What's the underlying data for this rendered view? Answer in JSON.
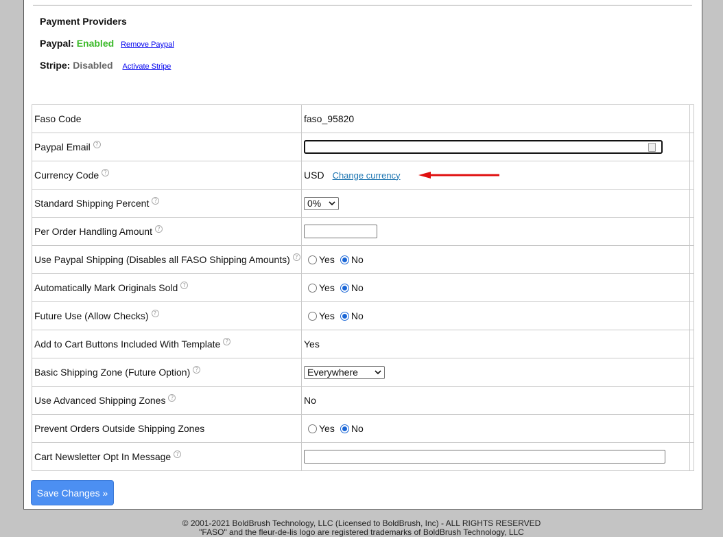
{
  "payment": {
    "title": "Payment Providers",
    "paypal": {
      "label": "Paypal:",
      "status": "Enabled",
      "action": "Remove Paypal"
    },
    "stripe": {
      "label": "Stripe:",
      "status": "Disabled",
      "action": "Activate Stripe"
    }
  },
  "rows": [
    {
      "label": "Faso Code",
      "value": "faso_95820"
    },
    {
      "label": "Paypal Email",
      "value": ""
    },
    {
      "label": "Currency Code",
      "value": "USD",
      "link": "Change currency"
    },
    {
      "label": "Standard Shipping Percent",
      "value": "0%"
    },
    {
      "label": "Per Order Handling Amount",
      "value": ""
    },
    {
      "label": "Use Paypal Shipping (Disables all FASO Shipping Amounts)",
      "value": "No"
    },
    {
      "label": "Automatically Mark Originals Sold",
      "value": "No"
    },
    {
      "label": "Future Use (Allow Checks)",
      "value": "No"
    },
    {
      "label": "Add to Cart Buttons Included With Template",
      "value": "Yes"
    },
    {
      "label": "Basic Shipping Zone (Future Option)",
      "value": "Everywhere"
    },
    {
      "label": "Use Advanced Shipping Zones",
      "value": "No"
    },
    {
      "label": "Prevent Orders Outside Shipping Zones",
      "value": "No"
    },
    {
      "label": "Cart Newsletter Opt In Message",
      "value": ""
    }
  ],
  "radio": {
    "yes": "Yes",
    "no": "No"
  },
  "help_glyph": "?",
  "save_label": "Save Changes »",
  "footer": {
    "line1": "© 2001-2021 BoldBrush Technology, LLC (Licensed to BoldBrush, Inc) - ALL RIGHTS RESERVED",
    "line2": "\"FASO\" and the fleur-de-lis logo are registered trademarks of BoldBrush Technology, LLC"
  },
  "colors": {
    "enabled": "#3cba2a",
    "disabled": "#666666",
    "link": "#0000ee",
    "button": "#4c8ff2",
    "arrow": "#e01010"
  }
}
